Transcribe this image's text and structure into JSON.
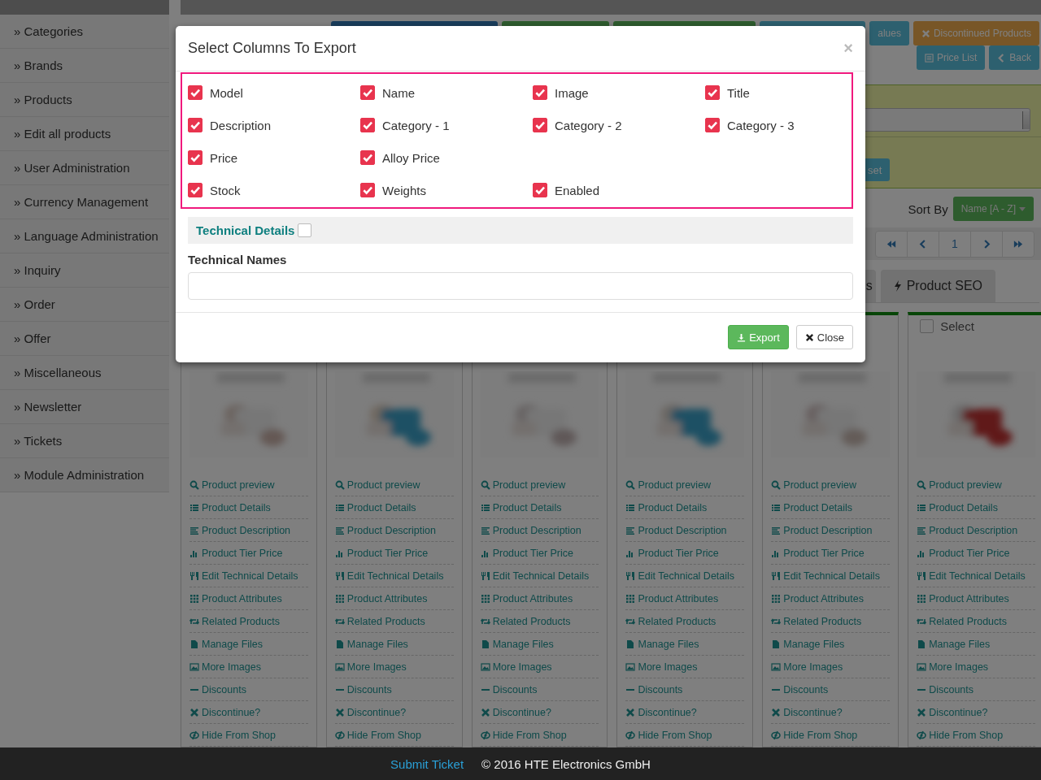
{
  "sidebar": {
    "items": [
      {
        "label": "» Categories"
      },
      {
        "label": "» Brands"
      },
      {
        "label": "» Products"
      },
      {
        "label": "» Edit all products"
      },
      {
        "label": "» User Administration"
      },
      {
        "label": "» Currency Management"
      },
      {
        "label": "» Language Administration"
      },
      {
        "label": "» Inquiry"
      },
      {
        "label": "» Order"
      },
      {
        "label": "» Offer"
      },
      {
        "label": "» Miscellaneous"
      },
      {
        "label": "» Newsletter"
      },
      {
        "label": "» Tickets"
      },
      {
        "label": "» Module Administration"
      }
    ]
  },
  "toolbar": {
    "buttons": [
      {
        "label": "alues",
        "kind": "info"
      },
      {
        "label": "Discontinued Products",
        "kind": "warning"
      }
    ],
    "second_row": [
      {
        "label": "Price List",
        "kind": "list"
      },
      {
        "label": "Back",
        "kind": "back"
      }
    ]
  },
  "filter": {
    "reset_button": "set"
  },
  "sort": {
    "label": "Sort By",
    "value": "Name [A - Z]"
  },
  "pagination": {
    "page": "1"
  },
  "tabs": [
    {
      "label": "s",
      "selected": false
    },
    {
      "label": "Product SEO",
      "selected": false
    }
  ],
  "products": [
    {
      "actions": [
        "Product preview",
        "Product Details",
        "Product Description",
        "Product Tier Price",
        "Edit Technical Details",
        "Product Attributes",
        "Related Products",
        "Manage Files",
        "More Images",
        "Discounts",
        "Discontinue?",
        "Hide From Shop"
      ]
    },
    {
      "actions": [
        "Product preview",
        "Product Details",
        "Product Description",
        "Product Tier Price",
        "Edit Technical Details",
        "Product Attributes",
        "Related Products",
        "Manage Files",
        "More Images",
        "Discounts",
        "Discontinue?",
        "Hide From Shop"
      ]
    },
    {
      "actions": [
        "Product preview",
        "Product Details",
        "Product Description",
        "Product Tier Price",
        "Edit Technical Details",
        "Product Attributes",
        "Related Products",
        "Manage Files",
        "More Images",
        "Discounts",
        "Discontinue?",
        "Hide From Shop"
      ]
    },
    {
      "actions": [
        "Product preview",
        "Product Details",
        "Product Description",
        "Product Tier Price",
        "Edit Technical Details",
        "Product Attributes",
        "Related Products",
        "Manage Files",
        "More Images",
        "Discounts",
        "Discontinue?",
        "Hide From Shop"
      ]
    },
    {
      "actions": [
        "Product preview",
        "Product Details",
        "Product Description",
        "Product Tier Price",
        "Edit Technical Details",
        "Product Attributes",
        "Related Products",
        "Manage Files",
        "More Images",
        "Discounts",
        "Discontinue?",
        "Hide From Shop"
      ]
    },
    {
      "select": {
        "label": "Select",
        "checked": false
      },
      "actions": [
        "Product preview",
        "Product Details",
        "Product Description",
        "Product Tier Price",
        "Edit Technical Details",
        "Product Attributes",
        "Related Products",
        "Manage Files",
        "More Images",
        "Discounts",
        "Discontinue?",
        "Hide From Shop"
      ]
    }
  ],
  "modal": {
    "title": "Select Columns To Export",
    "close": "×",
    "column_rows": [
      [
        {
          "label": "Model",
          "checked": true
        },
        {
          "label": "Name",
          "checked": true
        },
        {
          "label": "Image",
          "checked": true
        },
        {
          "label": "Title",
          "checked": true
        }
      ],
      [
        {
          "label": "Description",
          "checked": true
        },
        {
          "label": "Category - 1",
          "checked": true
        },
        {
          "label": "Category - 2",
          "checked": true
        },
        {
          "label": "Category - 3",
          "checked": true
        }
      ],
      [
        {
          "label": "Price",
          "checked": true
        },
        {
          "label": "Alloy Price",
          "checked": true
        }
      ],
      [
        {
          "label": "Stock",
          "checked": true
        },
        {
          "label": "Weights",
          "checked": true
        },
        {
          "label": "Enabled",
          "checked": true
        }
      ]
    ],
    "technical_details": {
      "label": "Technical Details",
      "checked": false
    },
    "technical_names": {
      "label": "Technical Names"
    },
    "buttons": [
      {
        "label": "Export",
        "kind": "export"
      },
      {
        "label": "Close",
        "kind": "close"
      }
    ]
  },
  "footer": {
    "link": "Submit Ticket",
    "copyright": "© 2016 HTE Electronics GmbH"
  }
}
